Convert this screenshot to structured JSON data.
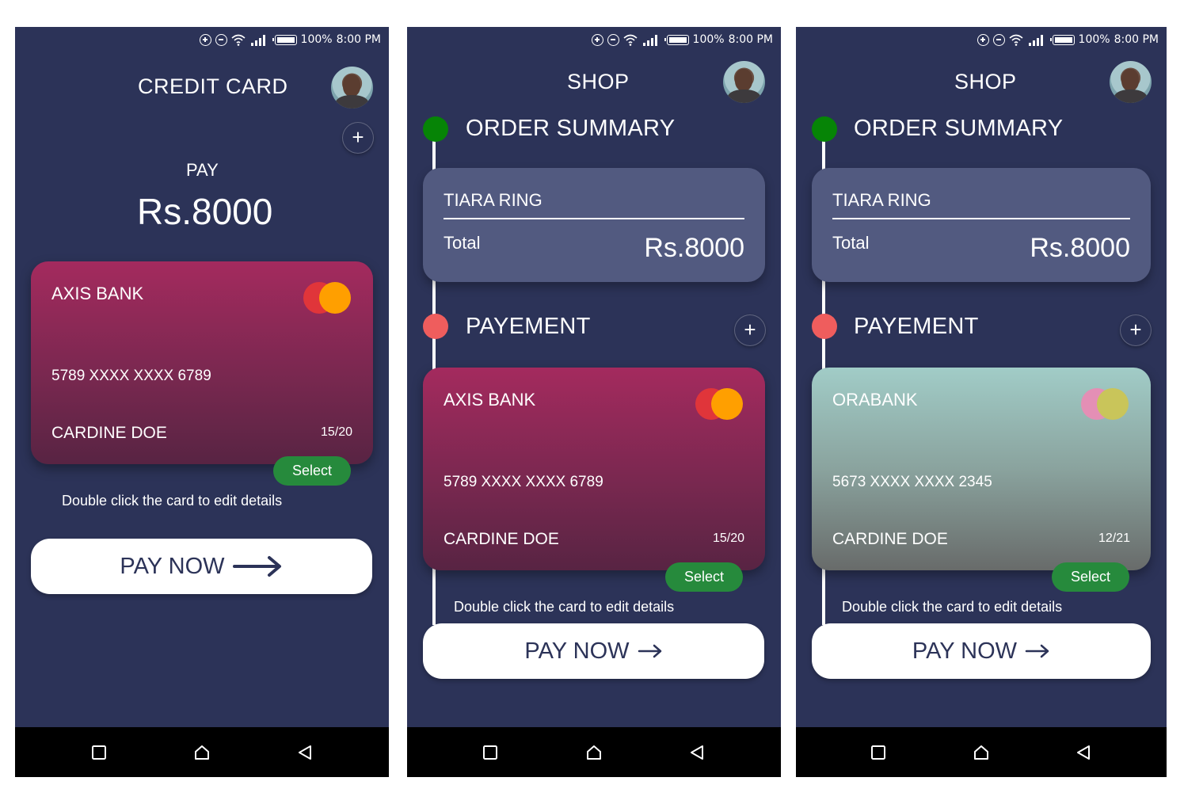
{
  "status_bar": {
    "battery": "100%",
    "time": "8:00 PM"
  },
  "screen1": {
    "title": "CREDIT CARD",
    "pay_label": "PAY",
    "amount": "Rs.8000",
    "card": {
      "bank": "AXIS BANK",
      "number": "5789 XXXX XXXX 6789",
      "holder": "CARDINE DOE",
      "expiry": "15/20"
    },
    "select_label": "Select",
    "hint": "Double click the card to edit details",
    "pay_now": "PAY NOW"
  },
  "screen2": {
    "title": "SHOP",
    "order_summary": "ORDER SUMMARY",
    "item": "TIARA RING",
    "total_label": "Total",
    "total_value": "Rs.8000",
    "payment": "PAYEMENT",
    "card": {
      "bank": "AXIS BANK",
      "number": "5789 XXXX XXXX 6789",
      "holder": "CARDINE DOE",
      "expiry": "15/20"
    },
    "select_label": "Select",
    "hint": "Double click the card to edit details",
    "pay_now": "PAY NOW"
  },
  "screen3": {
    "title": "SHOP",
    "order_summary": "ORDER SUMMARY",
    "item": "TIARA RING",
    "total_label": "Total",
    "total_value": "Rs.8000",
    "payment": "PAYEMENT",
    "card": {
      "bank": "ORABANK",
      "number": "5673 XXXX XXXX 2345",
      "holder": "CARDINE DOE",
      "expiry": "12/21"
    },
    "select_label": "Select",
    "hint": "Double click the card to edit details",
    "pay_now": "PAY NOW"
  },
  "colors": {
    "background": "#2c3358",
    "select": "#268a3c",
    "step_done": "#068406",
    "step_current": "#ef5d5d",
    "summary_card": "#525a80"
  },
  "icons": [
    "add-circle-icon",
    "dnd-icon",
    "wifi-icon",
    "signal-icon",
    "battery-icon",
    "plus-icon",
    "mastercard-icon",
    "arrow-right-icon",
    "recent-apps-icon",
    "home-icon",
    "back-icon"
  ]
}
